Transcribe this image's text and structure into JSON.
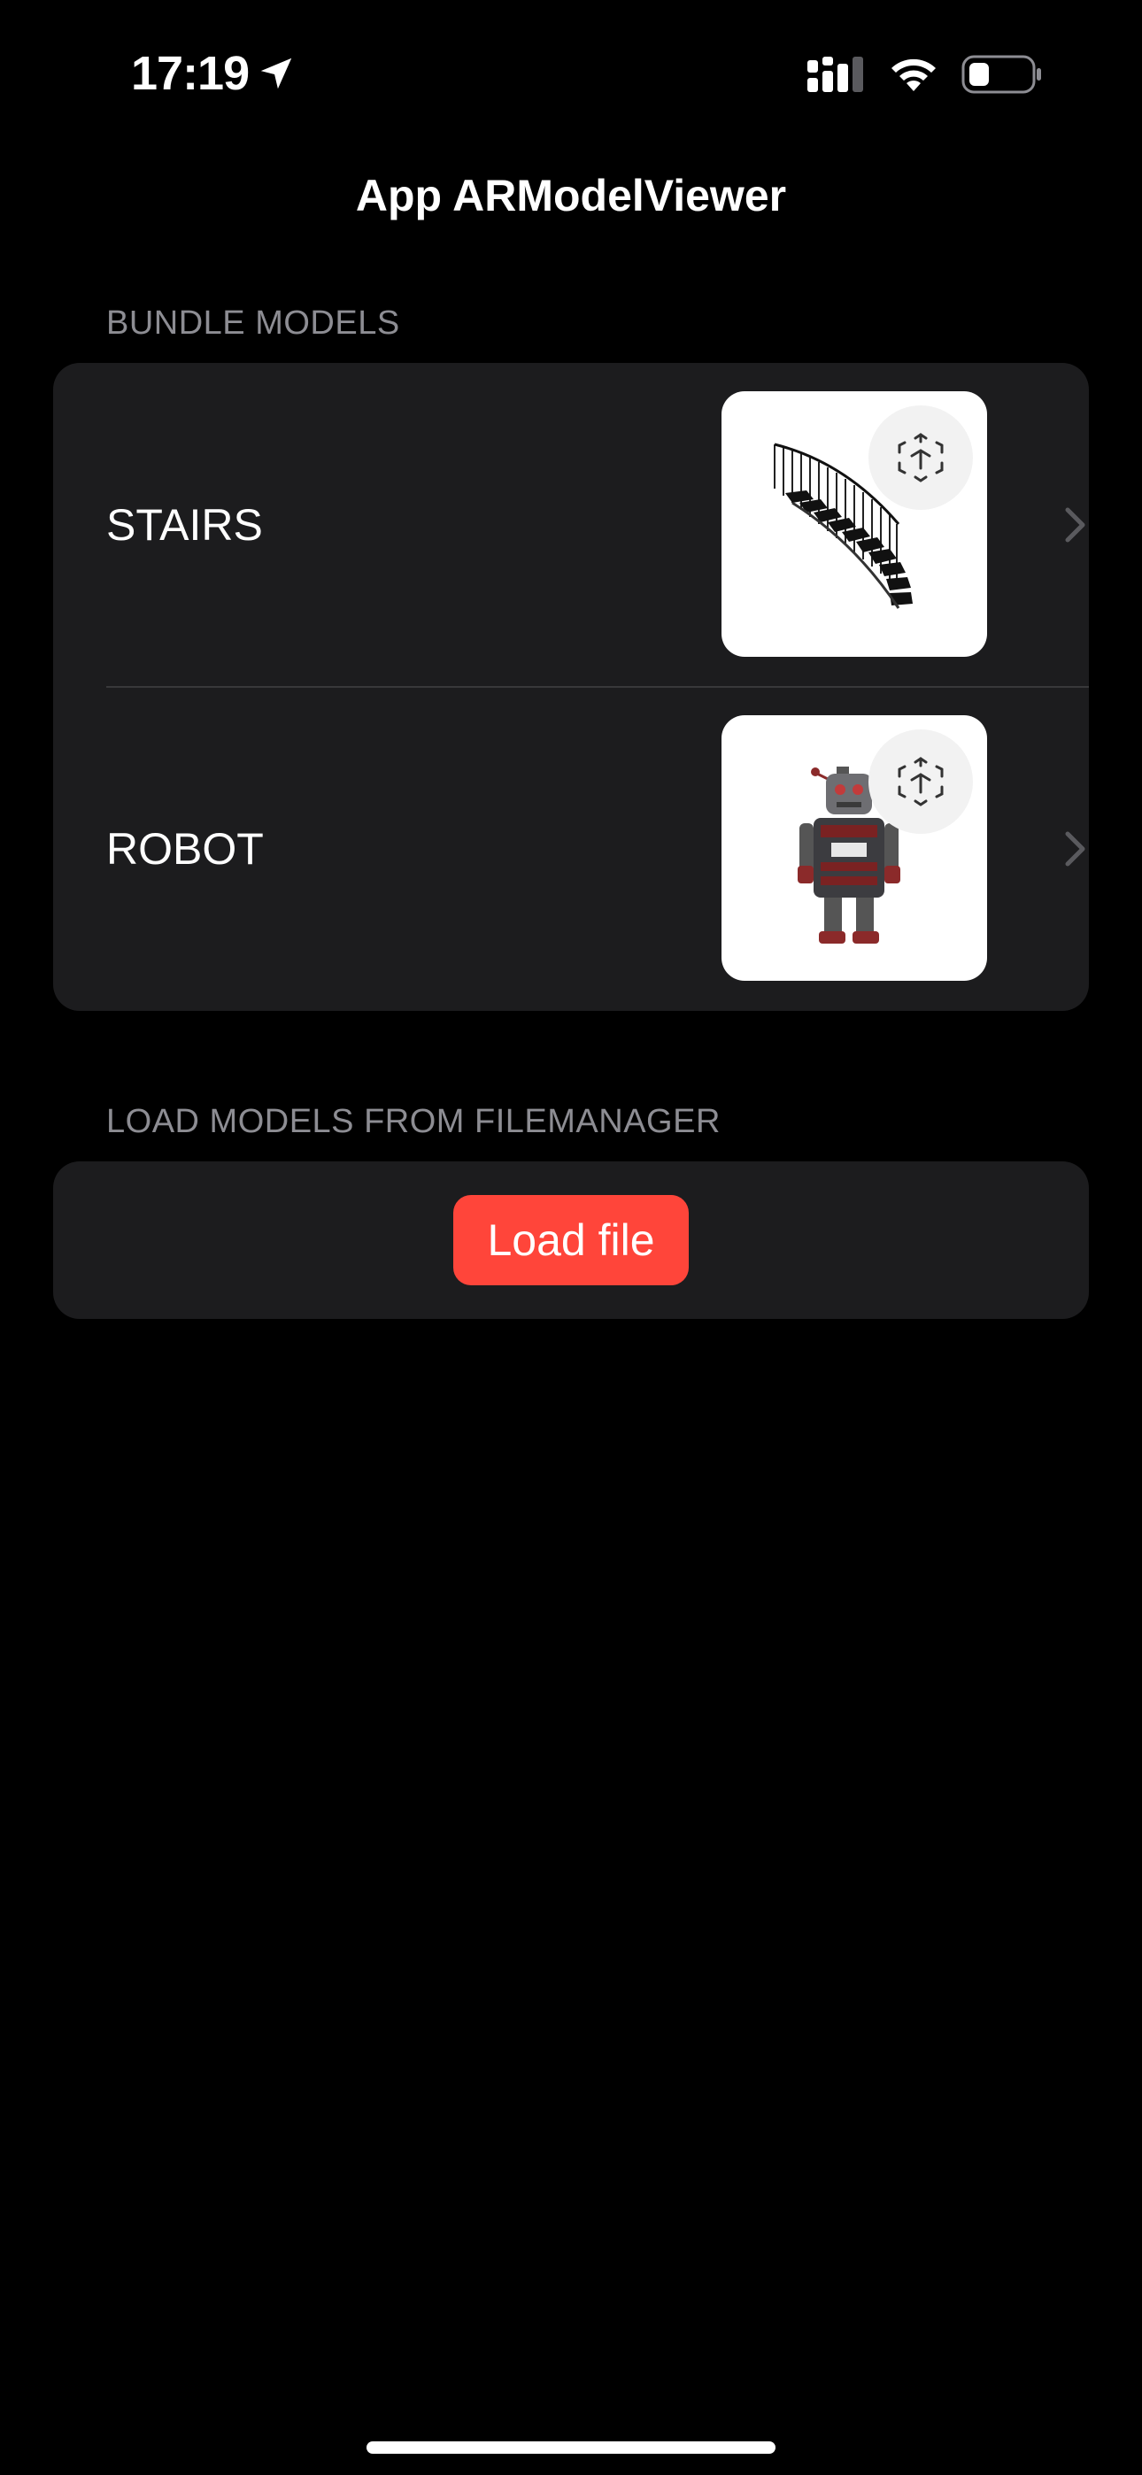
{
  "status_bar": {
    "time": "17:19",
    "icons": [
      "location-arrow-icon",
      "cellular-signal-icon",
      "wifi-icon",
      "battery-icon"
    ]
  },
  "nav": {
    "title": "App ARModelViewer"
  },
  "bundle_section": {
    "header": "BUNDLE MODELS",
    "items": [
      {
        "label": "STAIRS",
        "thumbnail": "stairs-model-thumbnail",
        "badge_icon": "ar-cube-icon"
      },
      {
        "label": "ROBOT",
        "thumbnail": "robot-model-thumbnail",
        "badge_icon": "ar-cube-icon"
      }
    ]
  },
  "file_section": {
    "header": "LOAD MODELS FROM FILEMANAGER",
    "button_label": "Load file"
  },
  "colors": {
    "background": "#000000",
    "group_background": "#1c1c1e",
    "header_text": "#8d8d93",
    "accent_red": "#ff453a",
    "chevron": "#5a5a5e"
  }
}
